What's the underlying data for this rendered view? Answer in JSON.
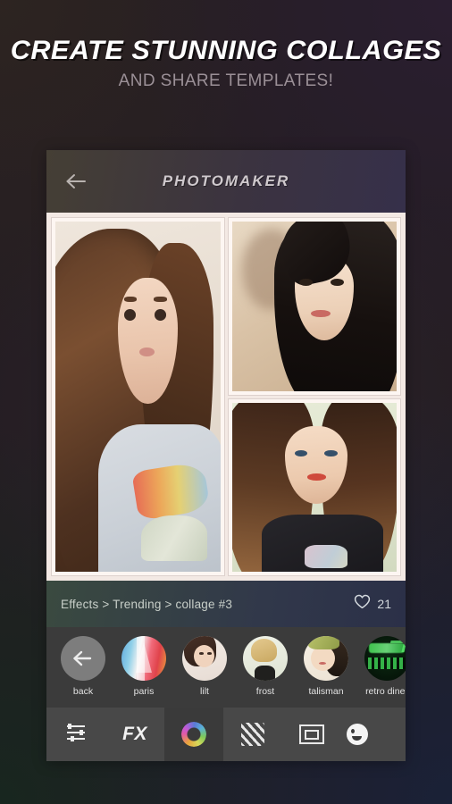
{
  "promo": {
    "headline": "CREATE STUNNING COLLAGES",
    "subline": "AND SHARE TEMPLATES!"
  },
  "app": {
    "title": "PHOTOMAKER",
    "back_icon": "arrow-left-icon"
  },
  "collage": {
    "cells": [
      {
        "id": "photo-1",
        "description": "young woman with long brown hair, cream background"
      },
      {
        "id": "photo-2",
        "description": "woman with dark side-swept bangs, beige background"
      },
      {
        "id": "photo-3",
        "description": "woman with ombre hair and red lipstick, light green background"
      }
    ]
  },
  "meta": {
    "breadcrumb": "Effects > Trending > collage #3",
    "heart_icon": "heart-outline-icon",
    "like_count": "21"
  },
  "filters": {
    "items": [
      {
        "label": "back",
        "thumb": "back-arrow-icon"
      },
      {
        "label": "paris",
        "thumb": "eiffel-tower-thumb"
      },
      {
        "label": "lilt",
        "thumb": "portrait-thumb"
      },
      {
        "label": "frost",
        "thumb": "portrait-thumb"
      },
      {
        "label": "talisman",
        "thumb": "portrait-thumb"
      },
      {
        "label": "retro diner",
        "thumb": "neon-sign-thumb"
      }
    ]
  },
  "toolbar": {
    "items": [
      {
        "name": "adjust-sliders-icon",
        "label": "",
        "active": false
      },
      {
        "name": "fx-label",
        "label": "FX",
        "active": false
      },
      {
        "name": "color-wheel-icon",
        "label": "",
        "active": true
      },
      {
        "name": "texture-stripes-icon",
        "label": "",
        "active": false
      },
      {
        "name": "frame-border-icon",
        "label": "",
        "active": false
      },
      {
        "name": "sticker-icon",
        "label": "",
        "active": false
      }
    ]
  },
  "colors": {
    "panel": "#3b3b3b",
    "toolbar": "#484848",
    "toolbar_active": "#3a3a3a",
    "collage_mat": "#f3e9e4",
    "meta_bar_left": "#3a4a40",
    "meta_bar_right": "#2b3048",
    "headline": "#ffffff",
    "subline": "#9b9097"
  }
}
